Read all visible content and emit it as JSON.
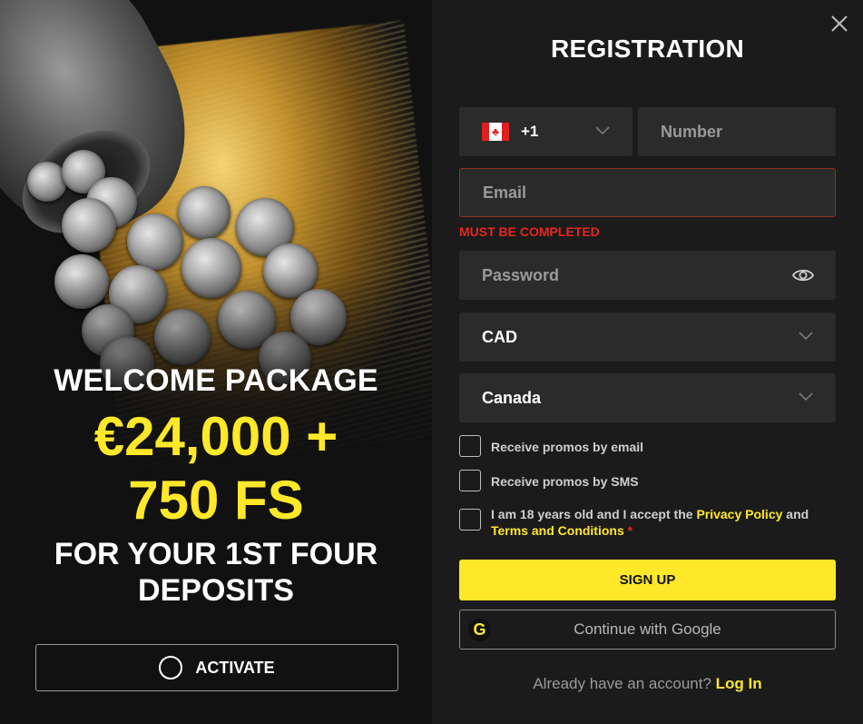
{
  "promo": {
    "title": "WELCOME PACKAGE",
    "amount": "€24,000 +",
    "free_spins": "750 FS",
    "subtitle": "FOR YOUR 1ST FOUR DEPOSITS",
    "activate_label": "ACTIVATE"
  },
  "form": {
    "title": "REGISTRATION",
    "phone_code": "+1",
    "phone_flag": "canada-flag",
    "phone_placeholder": "Number",
    "email_placeholder": "Email",
    "email_error": "MUST BE COMPLETED",
    "password_placeholder": "Password",
    "currency": "CAD",
    "country": "Canada",
    "promo_email_label": "Receive promos by email",
    "promo_sms_label": "Receive promos by SMS",
    "terms_prefix": "I am 18 years old and I accept the ",
    "privacy_link": "Privacy Policy",
    "terms_and": " and",
    "terms_link": "Terms and Conditions",
    "required_mark": "*",
    "signup_label": "SIGN UP",
    "google_label": "Continue with Google",
    "google_icon": "G",
    "login_prompt": "Already have an account? ",
    "login_link": "Log In"
  },
  "colors": {
    "accent": "#ffe82a",
    "error": "#e5271e",
    "panel": "#1b1b1b",
    "field": "#2b2b2b"
  }
}
